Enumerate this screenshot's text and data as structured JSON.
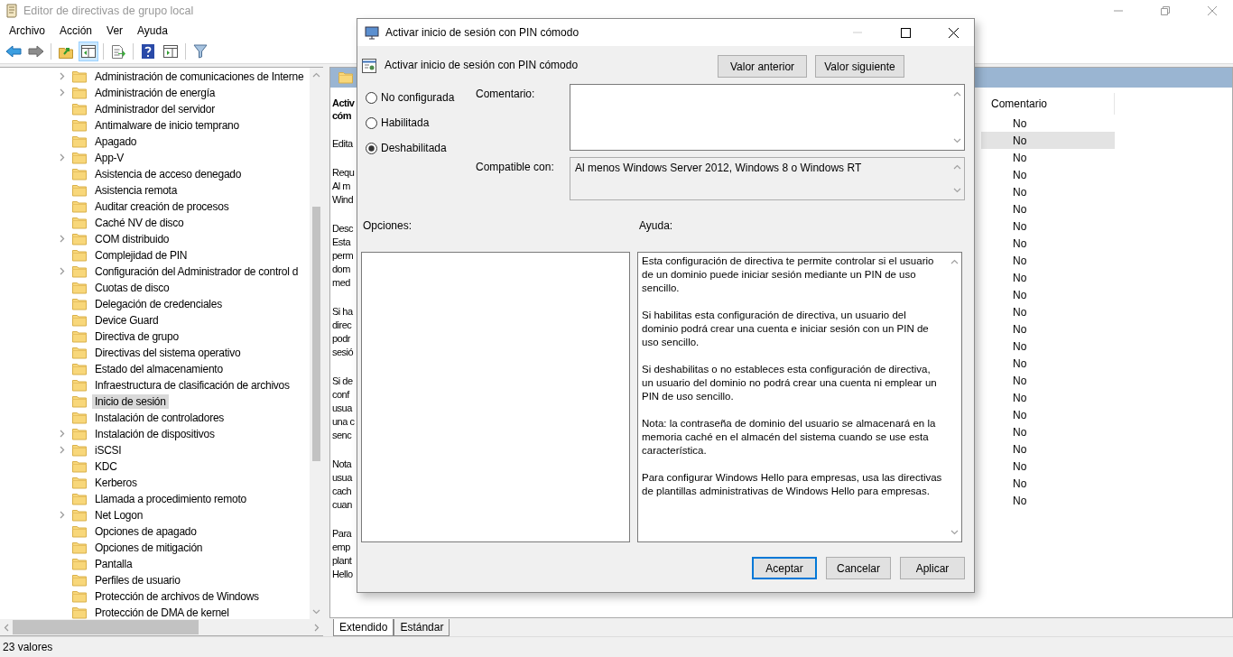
{
  "window": {
    "title": "Editor de directivas de grupo local"
  },
  "menu": [
    "Archivo",
    "Acción",
    "Ver",
    "Ayuda"
  ],
  "tree": {
    "items": [
      {
        "label": "Administración de comunicaciones de Interne",
        "expandable": true,
        "selected": false
      },
      {
        "label": "Administración de energía",
        "expandable": true,
        "selected": false
      },
      {
        "label": "Administrador del servidor",
        "expandable": false,
        "selected": false
      },
      {
        "label": "Antimalware de inicio temprano",
        "expandable": false,
        "selected": false
      },
      {
        "label": "Apagado",
        "expandable": false,
        "selected": false
      },
      {
        "label": "App-V",
        "expandable": true,
        "selected": false
      },
      {
        "label": "Asistencia de acceso denegado",
        "expandable": false,
        "selected": false
      },
      {
        "label": "Asistencia remota",
        "expandable": false,
        "selected": false
      },
      {
        "label": "Auditar creación de procesos",
        "expandable": false,
        "selected": false
      },
      {
        "label": "Caché NV de disco",
        "expandable": false,
        "selected": false
      },
      {
        "label": "COM distribuido",
        "expandable": true,
        "selected": false
      },
      {
        "label": "Complejidad de PIN",
        "expandable": false,
        "selected": false
      },
      {
        "label": "Configuración del Administrador de control d",
        "expandable": true,
        "selected": false
      },
      {
        "label": "Cuotas de disco",
        "expandable": false,
        "selected": false
      },
      {
        "label": "Delegación de credenciales",
        "expandable": false,
        "selected": false
      },
      {
        "label": "Device Guard",
        "expandable": false,
        "selected": false
      },
      {
        "label": "Directiva de grupo",
        "expandable": false,
        "selected": false
      },
      {
        "label": "Directivas del sistema operativo",
        "expandable": false,
        "selected": false
      },
      {
        "label": "Estado del almacenamiento",
        "expandable": false,
        "selected": false
      },
      {
        "label": "Infraestructura de clasificación de archivos",
        "expandable": false,
        "selected": false
      },
      {
        "label": "Inicio de sesión",
        "expandable": false,
        "selected": true
      },
      {
        "label": "Instalación de controladores",
        "expandable": false,
        "selected": false
      },
      {
        "label": "Instalación de dispositivos",
        "expandable": true,
        "selected": false
      },
      {
        "label": "iSCSI",
        "expandable": true,
        "selected": false
      },
      {
        "label": "KDC",
        "expandable": false,
        "selected": false
      },
      {
        "label": "Kerberos",
        "expandable": false,
        "selected": false
      },
      {
        "label": "Llamada a procedimiento remoto",
        "expandable": false,
        "selected": false
      },
      {
        "label": "Net Logon",
        "expandable": true,
        "selected": false
      },
      {
        "label": "Opciones de apagado",
        "expandable": false,
        "selected": false
      },
      {
        "label": "Opciones de mitigación",
        "expandable": false,
        "selected": false
      },
      {
        "label": "Pantalla",
        "expandable": false,
        "selected": false
      },
      {
        "label": "Perfiles de usuario",
        "expandable": false,
        "selected": false
      },
      {
        "label": "Protección de archivos de Windows",
        "expandable": false,
        "selected": false
      },
      {
        "label": "Protección de DMA de kernel",
        "expandable": false,
        "selected": false
      }
    ]
  },
  "details": {
    "heading": [
      "Activ",
      "cóm"
    ],
    "paragraphs": [
      [
        "Edita"
      ],
      [
        "Requ",
        "Al m",
        "Wind"
      ],
      [
        "Desc",
        "Esta",
        "perm",
        "dom",
        "med"
      ],
      [
        "Si ha",
        "direc",
        "podr",
        "sesió"
      ],
      [
        "Si de",
        "conf",
        "usua",
        "una c",
        "senc"
      ],
      [
        "Nota",
        "usua",
        "cach",
        "cuan"
      ],
      [
        "Para",
        "emp",
        "plant",
        "Hello"
      ]
    ]
  },
  "list": {
    "columns": [
      "Comentario"
    ],
    "rows": [
      {
        "comentario": "No",
        "selected": false
      },
      {
        "comentario": "No",
        "selected": true
      },
      {
        "comentario": "No",
        "selected": false
      },
      {
        "comentario": "No",
        "selected": false
      },
      {
        "comentario": "No",
        "selected": false
      },
      {
        "comentario": "No",
        "selected": false
      },
      {
        "comentario": "No",
        "selected": false
      },
      {
        "comentario": "No",
        "selected": false
      },
      {
        "comentario": "No",
        "selected": false
      },
      {
        "comentario": "No",
        "selected": false
      },
      {
        "comentario": "No",
        "selected": false
      },
      {
        "comentario": "No",
        "selected": false
      },
      {
        "comentario": "No",
        "selected": false
      },
      {
        "comentario": "No",
        "selected": false
      },
      {
        "comentario": "No",
        "selected": false
      },
      {
        "comentario": "No",
        "selected": false
      },
      {
        "comentario": "No",
        "selected": false
      },
      {
        "comentario": "No",
        "selected": false
      },
      {
        "comentario": "No",
        "selected": false
      },
      {
        "comentario": "No",
        "selected": false
      },
      {
        "comentario": "No",
        "selected": false
      },
      {
        "comentario": "No",
        "selected": false
      },
      {
        "comentario": "No",
        "selected": false
      }
    ]
  },
  "tabs": [
    {
      "label": "Extendido",
      "selected": true
    },
    {
      "label": "Estándar",
      "selected": false
    }
  ],
  "status_bar": "23 valores",
  "dialog": {
    "title": "Activar inicio de sesión con PIN cómodo",
    "policy_title": "Activar inicio de sesión con PIN cómodo",
    "nav_buttons": [
      "Valor anterior",
      "Valor siguiente"
    ],
    "states": [
      {
        "label": "No configurada",
        "selected": false
      },
      {
        "label": "Habilitada",
        "selected": false
      },
      {
        "label": "Deshabilitada",
        "selected": true
      }
    ],
    "comment_label": "Comentario:",
    "compatible_label": "Compatible con:",
    "compatible_value": "Al menos Windows Server 2012, Windows 8 o Windows RT",
    "options_label": "Opciones:",
    "help_label": "Ayuda:",
    "help": [
      "Esta configuración de directiva te permite controlar si el usuario de un dominio puede iniciar sesión mediante un PIN de uso sencillo.",
      "Si habilitas esta configuración de directiva, un usuario del dominio podrá crear una cuenta e iniciar sesión con un PIN de uso sencillo.",
      "Si deshabilitas o no estableces esta configuración de directiva, un usuario del dominio no podrá crear una cuenta ni emplear un PIN de uso sencillo.",
      "Nota: la contraseña de dominio del usuario se almacenará en la memoria caché en el almacén del sistema cuando se use esta característica.",
      "Para configurar Windows Hello para empresas, usa las directivas de plantillas administrativas de Windows Hello para empresas."
    ],
    "buttons": [
      {
        "label": "Aceptar",
        "focused": true
      },
      {
        "label": "Cancelar",
        "focused": false
      },
      {
        "label": "Aplicar",
        "focused": false
      }
    ]
  }
}
